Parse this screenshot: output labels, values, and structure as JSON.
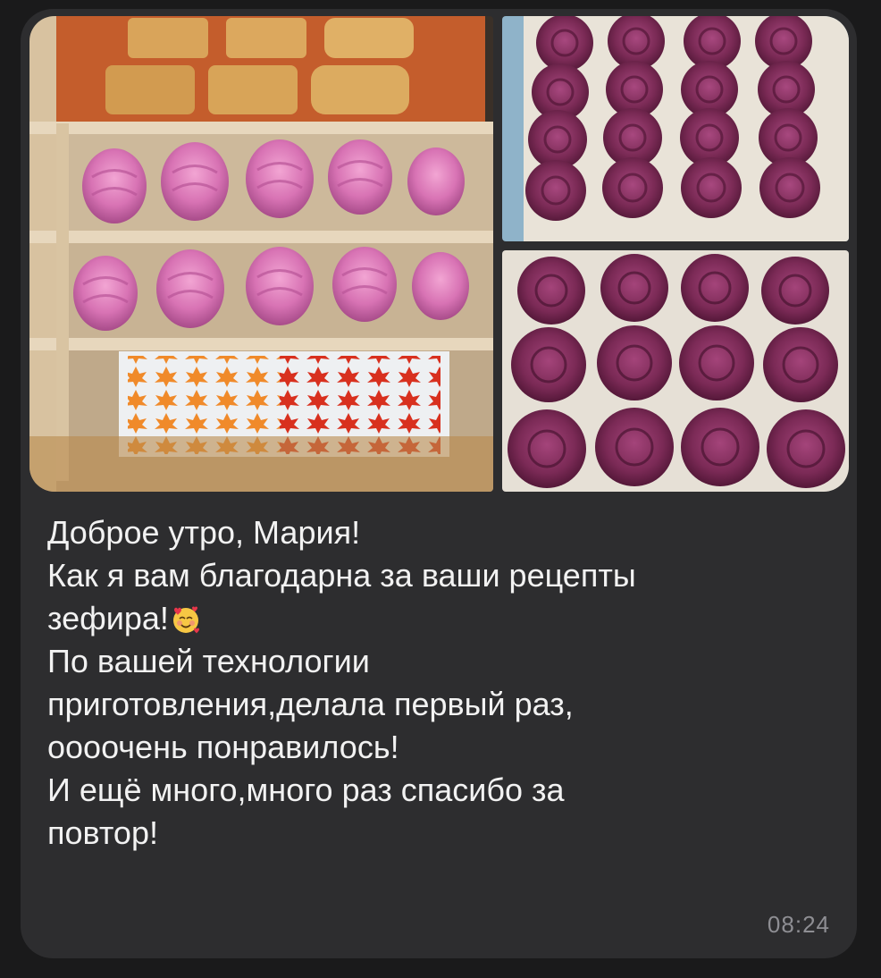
{
  "message": {
    "lines": [
      "Доброе утро, Мария!",
      "Как я вам благодарна за ваши рецепты",
      "зефира!",
      "По вашей технологии",
      "приготовления,делала первый раз,",
      "оооочень понравилось!",
      "И ещё много,много раз спасибо за",
      "повтор!"
    ],
    "emoji": "smiling-face-with-hearts-icon",
    "time": "08:24"
  },
  "photos": [
    {
      "name": "photo-shelves-marshmallow",
      "subject": "drying rack with gingerbread, pink marshmallow and leaf candies"
    },
    {
      "name": "photo-purple-zephyr-top",
      "subject": "tray of purple rose zephyr"
    },
    {
      "name": "photo-purple-zephyr-bottom",
      "subject": "tray of purple rose zephyr close-up"
    }
  ],
  "colors": {
    "background": "#1a1a1b",
    "bubble": "#2d2d2f",
    "text": "#f2f2f2",
    "time": "#8e8e93",
    "pink_zephyr": "#d873b4",
    "purple_zephyr": "#7a2a55"
  }
}
